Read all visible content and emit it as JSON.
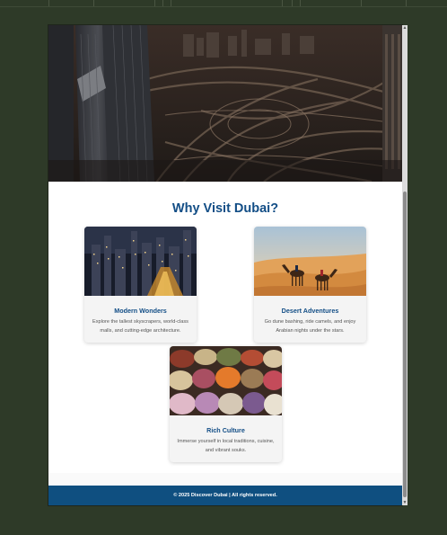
{
  "page": {
    "section_title": "Why Visit Dubai?",
    "footer": "© 2025 Discover Dubai | All rights reserved."
  },
  "cards": [
    {
      "title": "Modern Wonders",
      "description": "Explore the tallest skyscrapers, world-class malls, and cutting-edge architecture.",
      "image": "city-skyline-night-image"
    },
    {
      "title": "Desert Adventures",
      "description": "Go dune bashing, ride camels, and enjoy Arabian nights under the stars.",
      "image": "desert-camels-image"
    },
    {
      "title": "Rich Culture",
      "description": "Immerse yourself in local traditions, cuisine, and vibrant souks.",
      "image": "souk-spices-image"
    }
  ],
  "colors": {
    "accent": "#134e86",
    "footer_bg": "#0f4f80",
    "page_bg": "#2e3a28"
  }
}
